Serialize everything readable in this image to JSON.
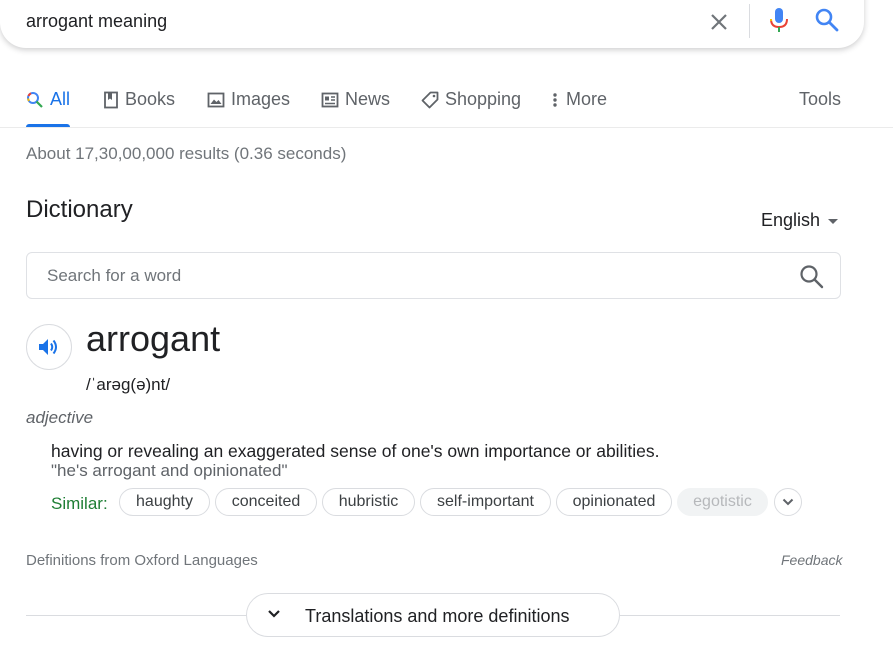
{
  "search": {
    "query": "arrogant meaning",
    "clear_icon": "close-icon",
    "voice_icon": "mic-icon",
    "submit_icon": "search-icon"
  },
  "tabs": [
    {
      "label": "All",
      "icon": "search-icon",
      "active": true
    },
    {
      "label": "Books",
      "icon": "book-icon"
    },
    {
      "label": "Images",
      "icon": "image-icon"
    },
    {
      "label": "News",
      "icon": "news-icon"
    },
    {
      "label": "Shopping",
      "icon": "tag-icon"
    },
    {
      "label": "More",
      "icon": "more-vert-icon"
    }
  ],
  "tools_label": "Tools",
  "result_stats": "About 17,30,00,000 results (0.36 seconds)",
  "dictionary": {
    "title": "Dictionary",
    "language": "English",
    "search_placeholder": "Search for a word",
    "word": "arrogant",
    "phonetic": "/ˈarəg(ə)nt/",
    "part_of_speech": "adjective",
    "definition": "having or revealing an exaggerated sense of one's own importance or abilities.",
    "example": "\"he's arrogant and opinionated\"",
    "similar_label": "Similar:",
    "similar": [
      "haughty",
      "conceited",
      "hubristic",
      "self-important",
      "opinionated",
      "egotistic"
    ],
    "source": "Definitions from Oxford Languages",
    "feedback": "Feedback",
    "more_button": "Translations and more definitions"
  },
  "colors": {
    "accent": "#1a73e8",
    "similar_label": "#1e7e34",
    "muted": "#70757a"
  }
}
